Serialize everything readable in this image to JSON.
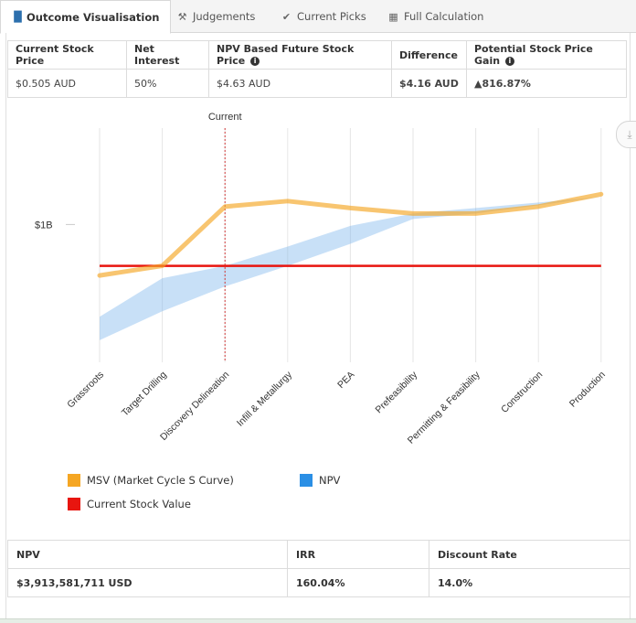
{
  "tabs": [
    {
      "label": "Outcome Visualisation",
      "icon": "bar-chart-icon",
      "glyph": "▐▌",
      "active": true
    },
    {
      "label": "Judgements",
      "icon": "gavel-icon",
      "glyph": "⚒",
      "active": false
    },
    {
      "label": "Current Picks",
      "icon": "check-icon",
      "glyph": "✔",
      "active": false
    },
    {
      "label": "Full Calculation",
      "icon": "calculator-icon",
      "glyph": "▦",
      "active": false
    }
  ],
  "summary": {
    "headers": [
      "Current Stock Price",
      "Net Interest",
      "NPV Based Future Stock Price",
      "Difference",
      "Potential Stock Price Gain"
    ],
    "values": [
      "$0.505 AUD",
      "50%",
      "$4.63 AUD",
      "$4.16 AUD",
      "▲816.87%"
    ]
  },
  "chart_data": {
    "type": "line",
    "categories": [
      "Grassroots",
      "Target Drilling",
      "Discovery Delineation",
      "Infill & Metallurgy",
      "PEA",
      "Prefeasibility",
      "Permitting & Feasibility",
      "Construction",
      "Production"
    ],
    "ytick_labels": [
      "$1B"
    ],
    "ytick_values": [
      1.0
    ],
    "ylim": [
      0,
      1.7
    ],
    "annotation": {
      "label": "Current",
      "category_index": 2
    },
    "series": [
      {
        "name": "MSV (Market Cycle S Curve)",
        "type": "line",
        "color": "#f5a623",
        "values": [
          0.63,
          0.7,
          1.13,
          1.17,
          1.12,
          1.08,
          1.08,
          1.13,
          1.22
        ]
      },
      {
        "name": "NPV",
        "type": "arearange",
        "color": "#7cb5ec",
        "low": [
          0.16,
          0.37,
          0.55,
          0.7,
          0.86,
          1.04,
          1.08,
          1.14,
          1.2
        ],
        "high": [
          0.33,
          0.61,
          0.7,
          0.84,
          0.99,
          1.08,
          1.12,
          1.16,
          1.2
        ]
      },
      {
        "name": "Current Stock Value",
        "type": "flat",
        "color": "#e8150f",
        "values": [
          0.7,
          0.7,
          0.7,
          0.7,
          0.7,
          0.7,
          0.7,
          0.7,
          0.7
        ]
      }
    ],
    "grid": "vertical"
  },
  "legend": [
    {
      "label": "MSV (Market Cycle S Curve)",
      "color": "#f5a623"
    },
    {
      "label": "NPV",
      "color": "#2b8fe5"
    },
    {
      "label": "Current Stock Value",
      "color": "#e8150f"
    }
  ],
  "npv_table": {
    "headers": [
      "NPV",
      "IRR",
      "Discount Rate"
    ],
    "values": [
      "$3,913,581,711 USD",
      "160.04%",
      "14.0%"
    ]
  },
  "download_icon": "download-icon"
}
